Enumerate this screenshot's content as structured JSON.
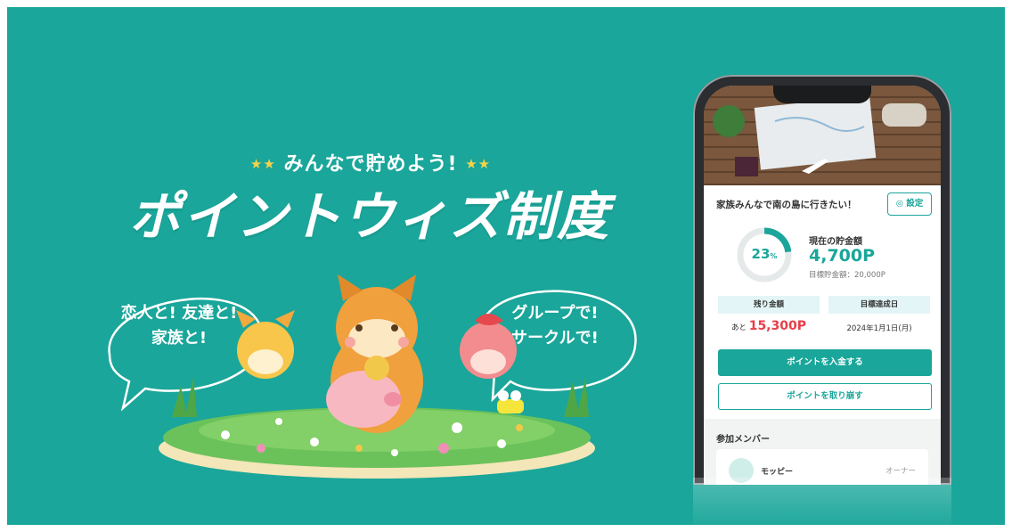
{
  "hero": {
    "tagline": "みんなで貯めよう!",
    "title": "ポイントウィズ制度",
    "bubble_left": "恋人と! 友達と!\n家族と!",
    "bubble_right": "グループで!\nサークルで!"
  },
  "app": {
    "goal_title": "家族みんなで南の島に行きたい！",
    "settings_label": "◎ 設定",
    "progress_percent": 23,
    "progress_percent_label": "23",
    "percent_sign": "%",
    "savings_label": "現在の貯金額",
    "savings_value": "4,700P",
    "target_line": "目標貯金額：20,000P",
    "remaining_header": "残り金額",
    "remaining_prefix": "あと",
    "remaining_value": "15,300P",
    "target_date_header": "目標達成日",
    "target_date_value": "2024年1月1日(月)",
    "deposit_button": "ポイントを入金する",
    "withdraw_button": "ポイントを取り崩す",
    "members_title": "参加メンバー",
    "member_name": "モッピー",
    "member_role": "オーナー"
  },
  "colors": {
    "background": "#1aa69a",
    "accent": "#1aa69a",
    "remaining": "#e83e48",
    "stars": "#f6d34a"
  }
}
